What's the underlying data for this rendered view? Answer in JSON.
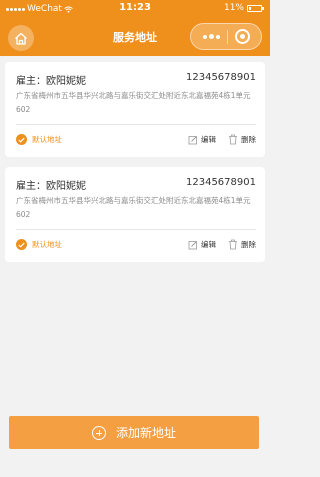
{
  "status_bar": {
    "carrier": "WeChat",
    "time": "11:23",
    "battery": "11%"
  },
  "nav": {
    "title": "服务地址",
    "home_icon": "home-icon",
    "more_icon": "more-dots-icon",
    "close_icon": "target-icon"
  },
  "addresses": [
    {
      "name": "雇主：欧阳妮妮",
      "phone": "12345678901",
      "address": "广东省梅州市五华县华兴北路与嘉乐街交汇处附近东北嘉福苑4栋1单元602",
      "default_label": "默认地址",
      "edit_label": "编辑",
      "delete_label": "删除"
    },
    {
      "name": "雇主：欧阳妮妮",
      "phone": "12345678901",
      "address": "广东省梅州市五华县华兴北路与嘉乐街交汇处附近东北嘉福苑4栋1单元602",
      "default_label": "默认地址",
      "edit_label": "编辑",
      "delete_label": "删除"
    }
  ],
  "add_button": {
    "label": "添加新地址"
  },
  "colors": {
    "accent": "#f0901c",
    "button": "#f59f43"
  }
}
